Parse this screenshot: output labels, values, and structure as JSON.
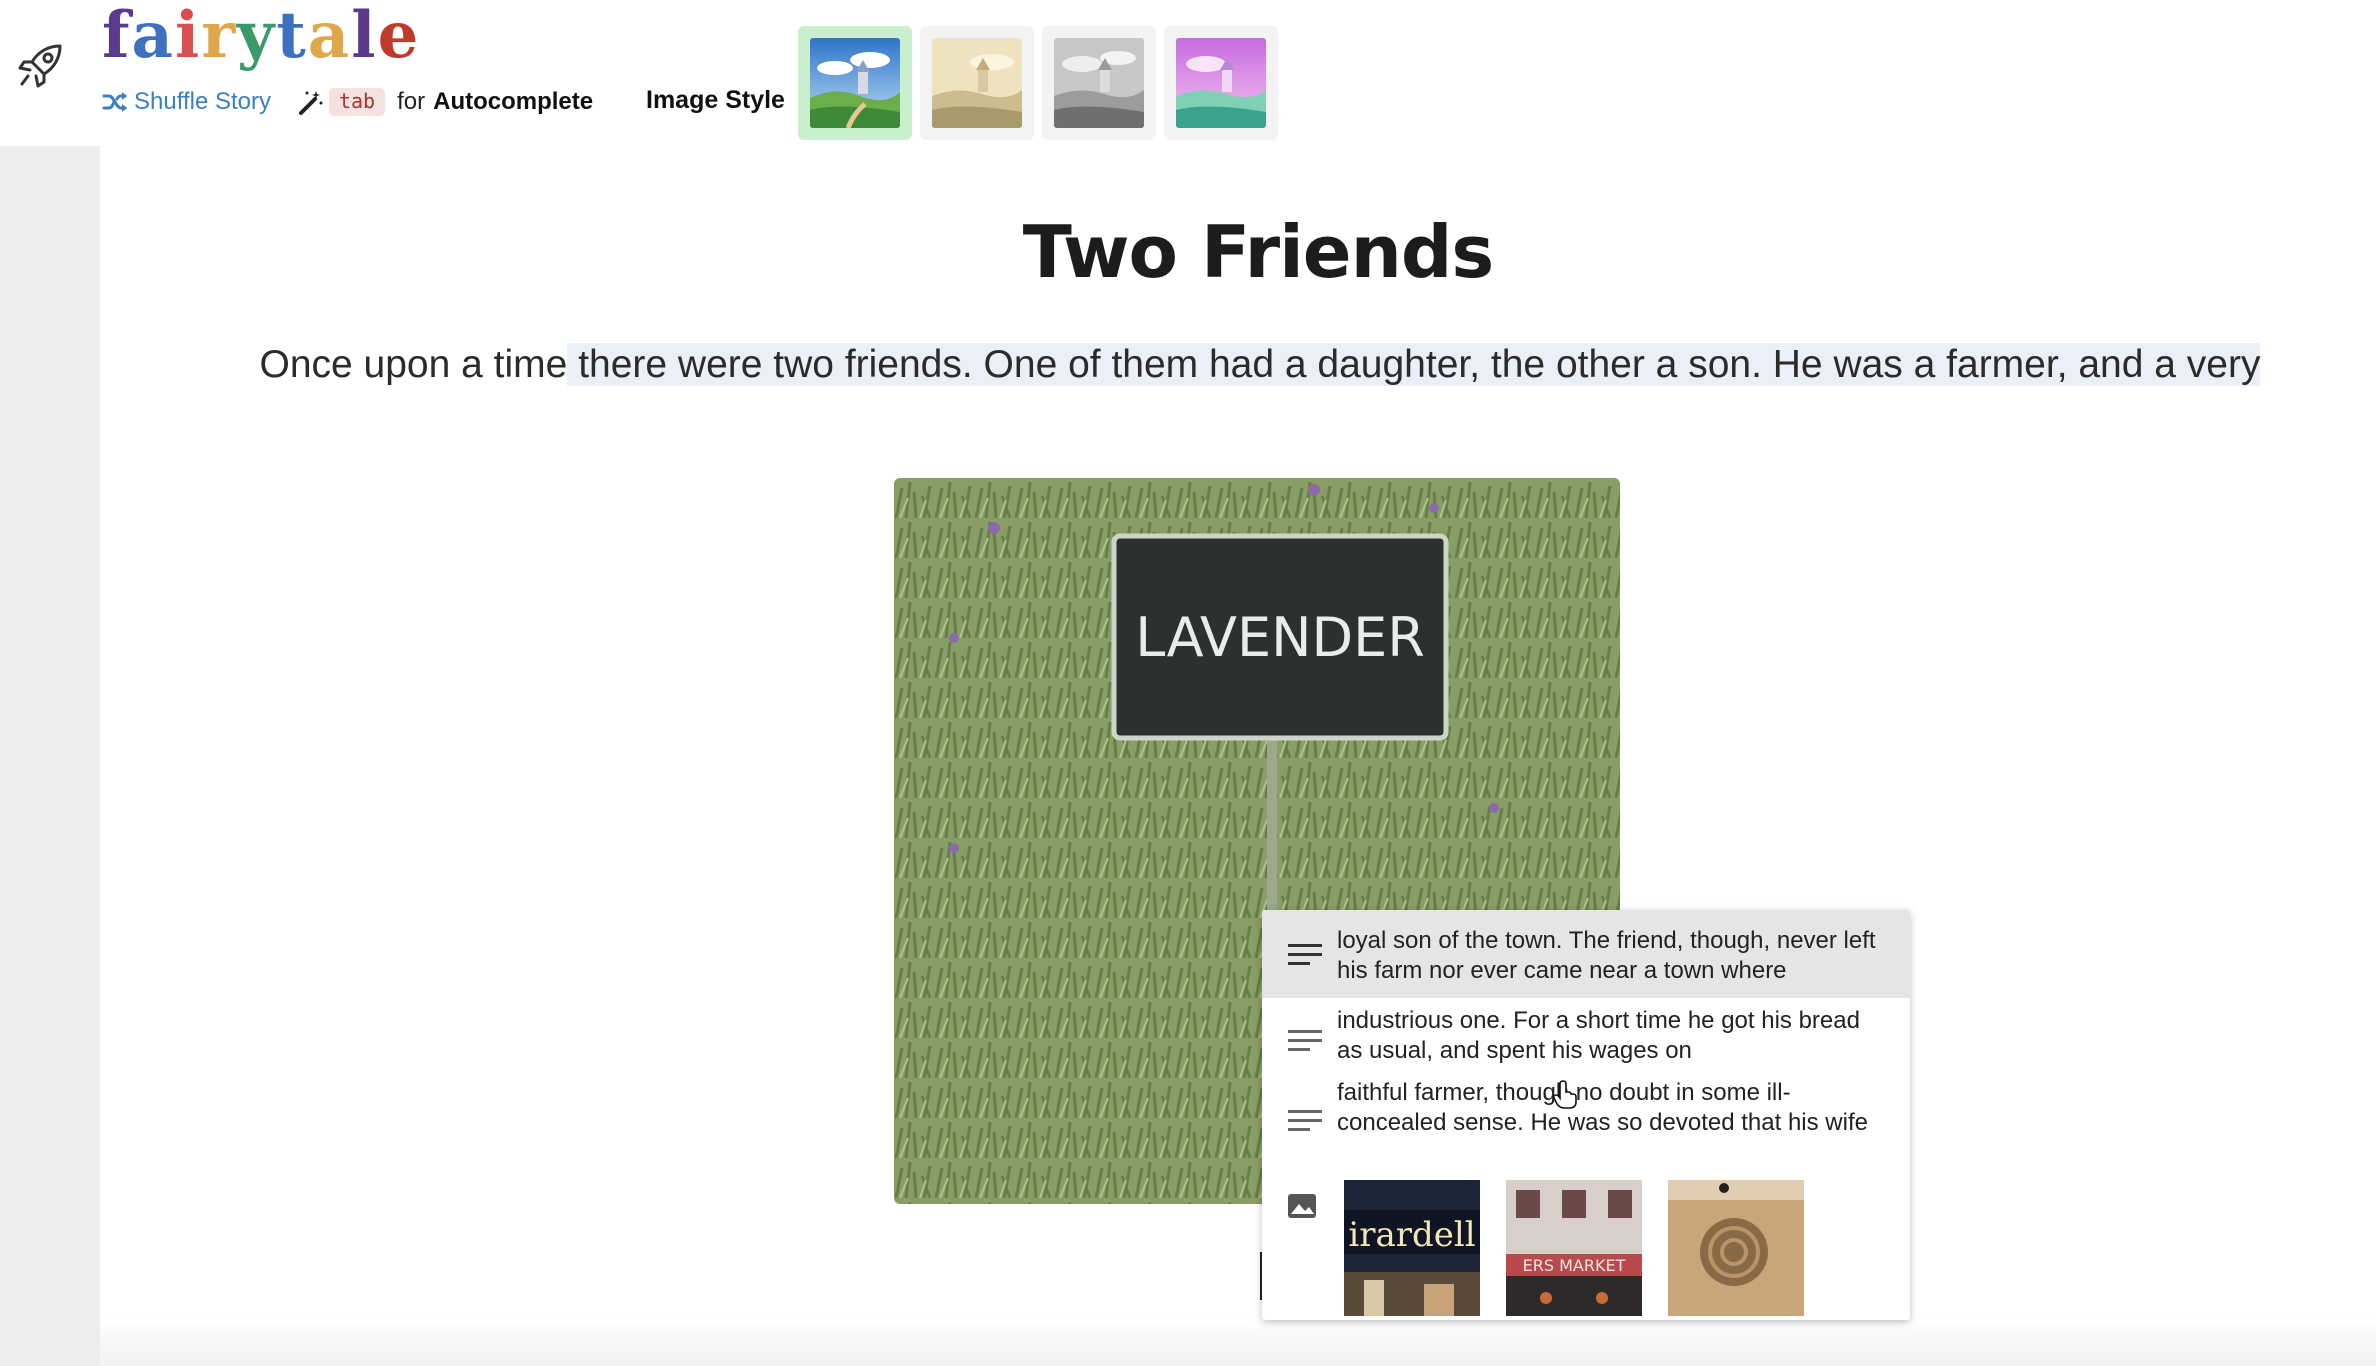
{
  "app": {
    "logo_letters": [
      "f",
      "a",
      "i",
      "r",
      "y",
      "t",
      "a",
      "l",
      "e"
    ],
    "logo_colors": [
      "#5a3a8c",
      "#3f6fbf",
      "#d94f4f",
      "#e0a64a",
      "#3a9a6a",
      "#3f6fbf",
      "#e0a64a",
      "#5a3a8c",
      "#c0392b"
    ]
  },
  "toolbar": {
    "shuffle_label": "Shuffle Story",
    "tab_key": "tab",
    "for_label": "for",
    "autocomplete_label": "Autocomplete",
    "image_style_label": "Image Style",
    "styles": [
      "color-landscape",
      "sepia-landscape",
      "grayscale-landscape",
      "pastel-landscape"
    ],
    "selected_style_index": 0
  },
  "story": {
    "title": "Two Friends",
    "prefix": "Once upon a time",
    "highlighted": " there were two friends. One of them had a daughter, the other a son. He was a farmer, and a very"
  },
  "main_image": {
    "sign_text": "LAVENDER"
  },
  "autocomplete_popup": {
    "suggestions": [
      {
        "text": "loyal son of the town. The friend, though, never left his farm nor ever came near a town where",
        "active": true
      },
      {
        "text": "industrious one. For a short time he got his bread as usual, and spent his wages on",
        "active": false
      },
      {
        "text": "faithful farmer, though no doubt in some ill-concealed sense. He was so devoted that his wife",
        "active": false
      }
    ],
    "image_options": [
      {
        "sign_text": "irardell"
      },
      {
        "sign_text": "ERS MARKET"
      },
      {
        "sign_text": ""
      }
    ]
  },
  "colors": {
    "accent_blue": "#3b7fc4",
    "selected_style_bg": "#c9efcf",
    "highlight_bg": "#eceef8",
    "kbd_bg": "#f4e2e2",
    "kbd_text": "#a83232"
  }
}
